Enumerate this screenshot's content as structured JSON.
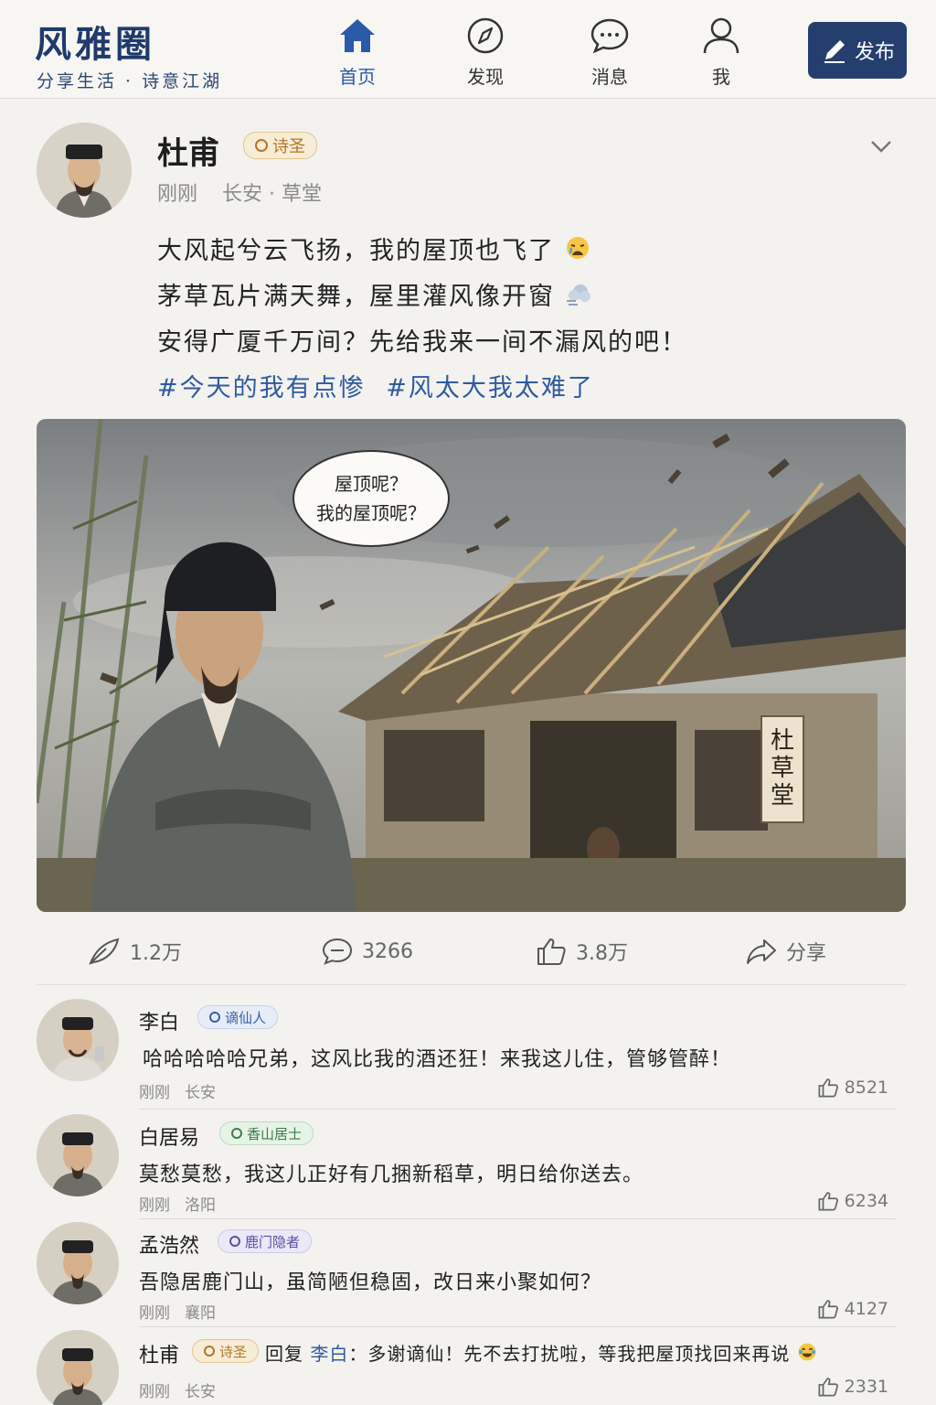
{
  "app": {
    "name": "风雅圈",
    "slogan": "分享生活 · 诗意江湖"
  },
  "nav": {
    "items": [
      {
        "label": "首页",
        "icon": "home-icon",
        "active": true
      },
      {
        "label": "发现",
        "icon": "compass-icon"
      },
      {
        "label": "消息",
        "icon": "chat-bubble-icon"
      },
      {
        "label": "我",
        "icon": "user-icon"
      }
    ],
    "publish": "发布"
  },
  "post": {
    "author": "杜甫",
    "badge": "诗圣",
    "time": "刚刚",
    "location": "长安 · 草堂",
    "lines": [
      "大风起兮云飞扬，我的屋顶也飞了",
      "茅草瓦片满天舞，屋里灌风像开窗",
      "安得广厦千万间？先给我来一间不漏风的吧！"
    ],
    "hashtags": [
      "#今天的我有点惨",
      "#风太大我太难了"
    ],
    "image": {
      "speech_line1": "屋顶呢？",
      "speech_line2": "我的屋顶呢？",
      "sign": [
        "杜",
        "草",
        "堂"
      ]
    },
    "stats": {
      "reposts": "1.2万",
      "comments": "3266",
      "likes": "3.8万",
      "share": "分享"
    }
  },
  "comments": [
    {
      "name": "李白",
      "badge": "谪仙人",
      "text": "哈哈哈哈哈兄弟，这风比我的酒还狂！来我这儿住，管够管醉！",
      "time": "刚刚",
      "location": "长安",
      "likes": "8521"
    },
    {
      "name": "白居易",
      "badge": "香山居士",
      "text": "莫愁莫愁，我这儿正好有几捆新稻草，明日给你送去。",
      "time": "刚刚",
      "location": "洛阳",
      "likes": "6234"
    },
    {
      "name": "孟浩然",
      "badge": "鹿门隐者",
      "text": "吾隐居鹿门山，虽简陋但稳固，改日来小聚如何？",
      "time": "刚刚",
      "location": "襄阳",
      "likes": "4127"
    },
    {
      "name": "杜甫",
      "badge": "诗圣",
      "reply_prefix": "回复",
      "reply_to": "李白",
      "text": "：多谢谪仙！先不去打扰啦，等我把屋顶找回来再说",
      "time": "刚刚",
      "location": "长安",
      "likes": "2331"
    }
  ],
  "colors": {
    "brand": "#1f3a6b",
    "accent": "#2a5aa8",
    "hashtag": "#2f5aa0",
    "publish_bg": "#243e6e"
  }
}
